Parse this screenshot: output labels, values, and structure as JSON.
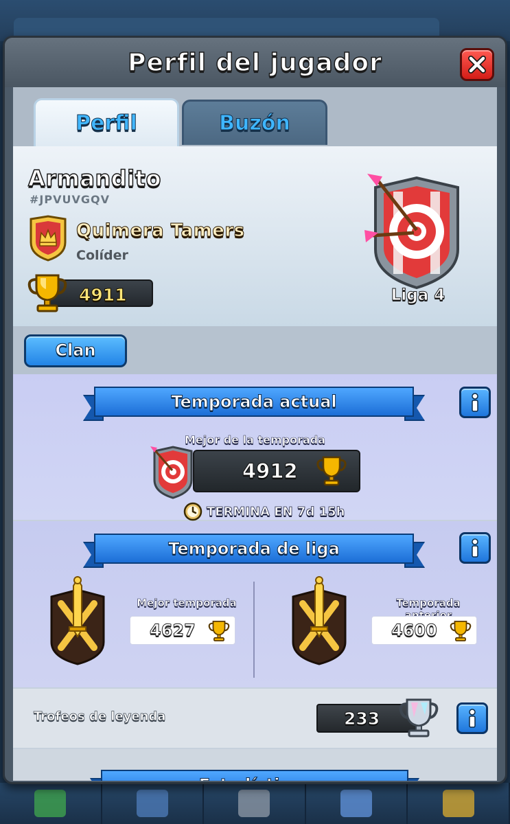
{
  "background": {
    "top_name": "Armandito"
  },
  "modal": {
    "title": "Perfil del jugador"
  },
  "tabs": [
    {
      "label": "Perfil",
      "active": true
    },
    {
      "label": "Buzón",
      "active": false
    }
  ],
  "player": {
    "name": "Armandito",
    "tag": "#JPVUVGQV",
    "clan_name": "Quimera Tamers",
    "clan_role": "Colíder",
    "trophies": "4911",
    "league": "Liga 4"
  },
  "clan_button": "Clan",
  "current_season": {
    "title": "Temporada actual",
    "best_label": "Mejor de la temporada",
    "best_value": "4912",
    "ends": "TERMINA EN 7d 15h"
  },
  "league_season": {
    "title": "Temporada de liga",
    "best_caption": "Mejor temporada",
    "best_value": "4627",
    "prev_caption": "Temporada anterior",
    "prev_value": "4600"
  },
  "legend": {
    "label": "Trofeos de leyenda",
    "value": "233"
  },
  "stats": {
    "title": "Estadísticas"
  },
  "colors": {
    "accent_blue": "#2384e6",
    "close_red": "#d31d17",
    "trophy_gold": "#f5b700"
  }
}
